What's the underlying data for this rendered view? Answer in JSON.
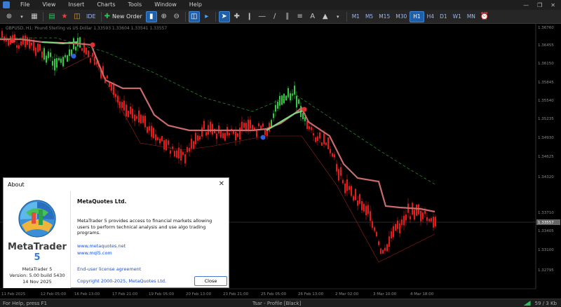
{
  "menu": [
    "File",
    "View",
    "Insert",
    "Charts",
    "Tools",
    "Window",
    "Help"
  ],
  "toolbar": {
    "ide_label": "IDE",
    "new_order_label": "New Order",
    "timeframes": [
      "M1",
      "M5",
      "M15",
      "M30",
      "H1",
      "H4",
      "D1",
      "W1",
      "MN"
    ],
    "active_timeframe": "H1"
  },
  "chart": {
    "symbol_info": "GBPUSD, H1:  Pound Sterling vs US Dollar  1.33593 1.33604 1.33541 1.33557",
    "price_labels": [
      "1.36760",
      "1.36455",
      "1.36150",
      "1.35845",
      "1.35540",
      "1.35235",
      "1.34930",
      "1.34625",
      "1.34320",
      "1.33710",
      "1.33405",
      "1.33100",
      "1.32795"
    ],
    "current_price": "1.33557",
    "time_labels": [
      "11 Feb 2025",
      "12 Feb 05:00",
      "16 Feb 13:00",
      "17 Feb 21:00",
      "19 Feb 05:00",
      "20 Feb 13:00",
      "23 Feb 21:00",
      "25 Feb 05:00",
      "26 Feb 13:00",
      "2 Mar 02:00",
      "3 Mar 10:00",
      "4 Mar 18:00"
    ],
    "colors": {
      "bull": "#2ecc40",
      "bear": "#e41b1b",
      "ma_band": "#c96b6b",
      "ma_green": "#7ed67e",
      "dashed_ma": "#1f8a2a"
    }
  },
  "about": {
    "title": "About",
    "brand_name": "MetaTrader",
    "brand_number": "5",
    "product": "MetaTrader 5",
    "version": "Version: 5.00 build 5430",
    "date": "14 Nov 2025",
    "company": "MetaQuotes Ltd.",
    "description": "MetaTrader 5 provides access to financial markets allowing users to perform technical analysis and use algo trading programs.",
    "link1": "www.metaquotes.net",
    "link2": "www.mql5.com",
    "license": "End-user license agreement",
    "copyright": "Copyright 2000-2025, MetaQuotes Ltd.",
    "close_label": "Close"
  },
  "status": {
    "help": "For Help, press F1",
    "profile": "Tsar - Profile [Black]",
    "traffic": "59 / 3 Kb"
  }
}
